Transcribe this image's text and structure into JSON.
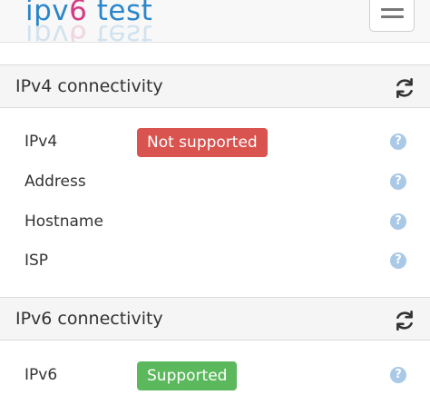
{
  "header": {
    "logo_ip": "ipv",
    "logo_v6": "6",
    "logo_test": " test",
    "menu_icon": "hamburger-icon"
  },
  "ipv4": {
    "title": "IPv4 connectivity",
    "refresh_icon": "refresh-icon",
    "rows": [
      {
        "label": "IPv4",
        "badge": "Not supported",
        "badge_color": "#d9534f"
      },
      {
        "label": "Address"
      },
      {
        "label": "Hostname"
      },
      {
        "label": "ISP"
      }
    ],
    "help_glyph": "?"
  },
  "ipv6": {
    "title": "IPv6 connectivity",
    "refresh_icon": "refresh-icon",
    "rows": [
      {
        "label": "IPv6",
        "badge": "Supported",
        "badge_color": "#5cb85c"
      }
    ],
    "help_glyph": "?"
  }
}
